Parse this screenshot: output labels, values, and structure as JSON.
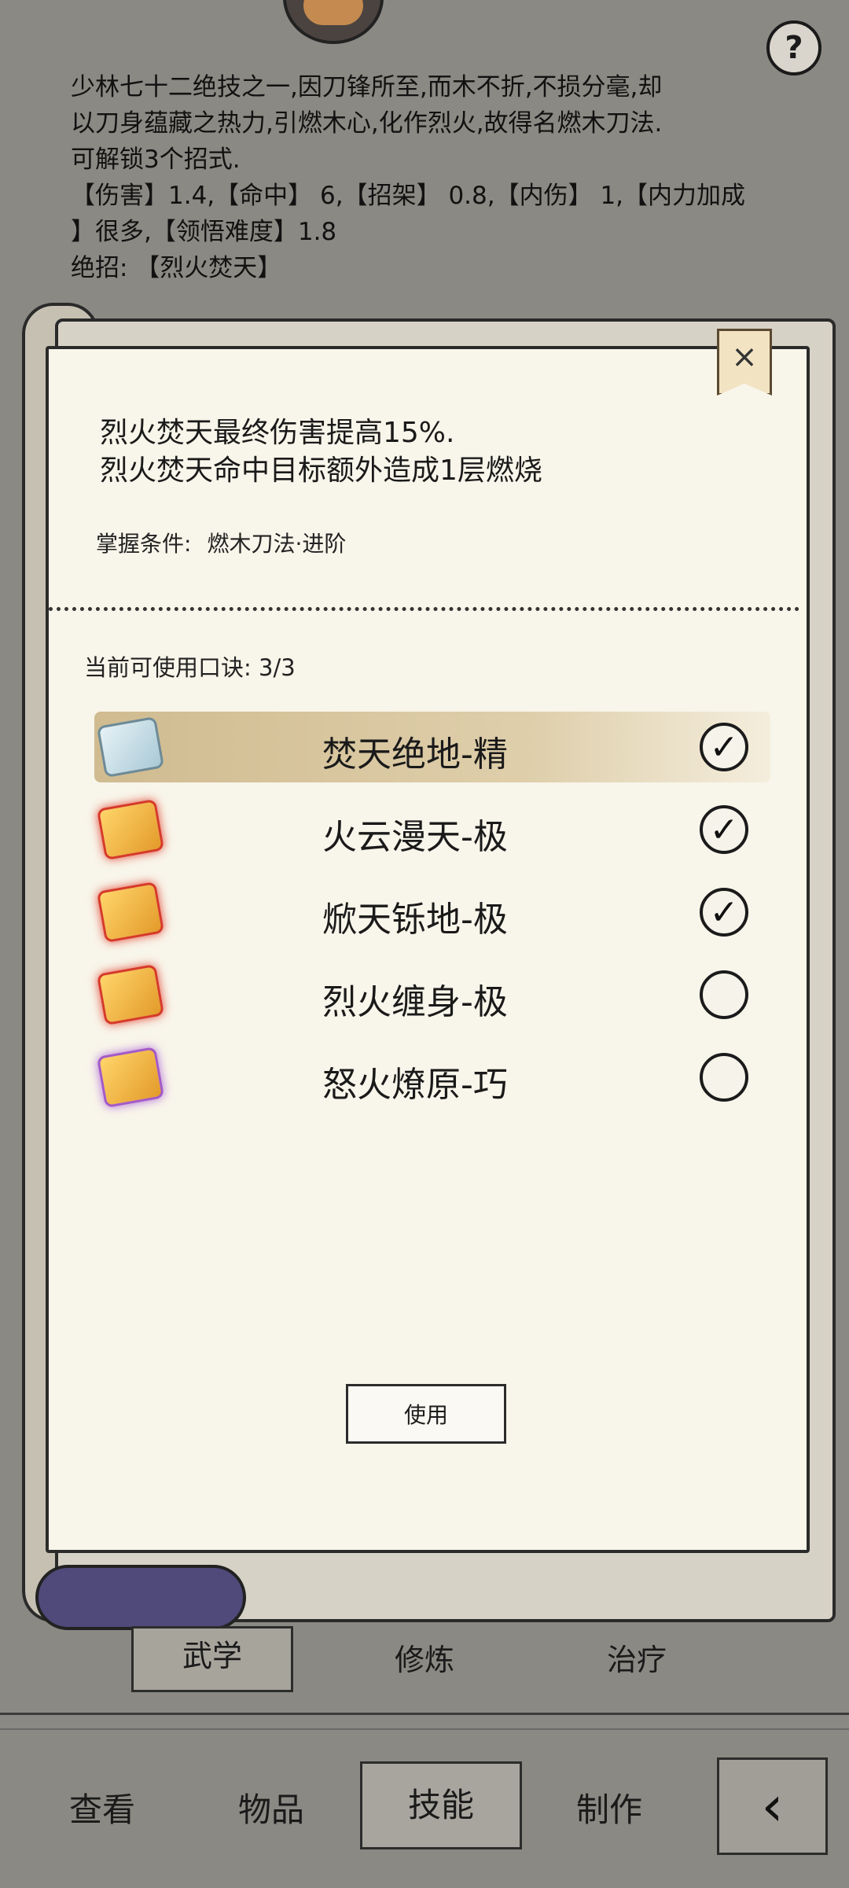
{
  "header": {
    "description_lines": [
      "少林七十二绝技之一,因刀锋所至,而木不折,不损分毫,却",
      "以刀身蕴藏之热力,引燃木心,化作烈火,故得名燃木刀法.",
      "可解锁3个招式.",
      "【伤害】1.4,【命中】 6,【招架】 0.8,【内伤】 1,【内力加成",
      "】很多,【领悟难度】1.8",
      "绝招: 【烈火焚天】"
    ],
    "help_label": "?"
  },
  "dialog": {
    "close_label": "×",
    "effects": [
      "烈火焚天最终伤害提高15%.",
      "烈火焚天命中目标额外造成1层燃烧"
    ],
    "condition_label": "掌握条件:",
    "condition_value": "燃木刀法·进阶",
    "available_label": "当前可使用口诀: 3/3",
    "items": [
      {
        "name": "焚天绝地-精",
        "checked": true,
        "icon": "scroll-blue-icon",
        "highlighted": true
      },
      {
        "name": "火云漫天-极",
        "checked": true,
        "icon": "scroll-gold-icon",
        "highlighted": false
      },
      {
        "name": "焮天铄地-极",
        "checked": true,
        "icon": "scroll-gold-icon",
        "highlighted": false
      },
      {
        "name": "烈火缠身-极",
        "checked": false,
        "icon": "scroll-gold-icon",
        "highlighted": false
      },
      {
        "name": "怒火燎原-巧",
        "checked": false,
        "icon": "scroll-purple-icon",
        "highlighted": false
      }
    ],
    "use_button": "使用"
  },
  "subtabs": [
    "武学",
    "修炼",
    "治疗"
  ],
  "subtab_selected": "武学",
  "tabs": [
    "查看",
    "物品",
    "技能",
    "制作"
  ],
  "tab_selected": "技能",
  "back_icon": "back-arrow-icon"
}
